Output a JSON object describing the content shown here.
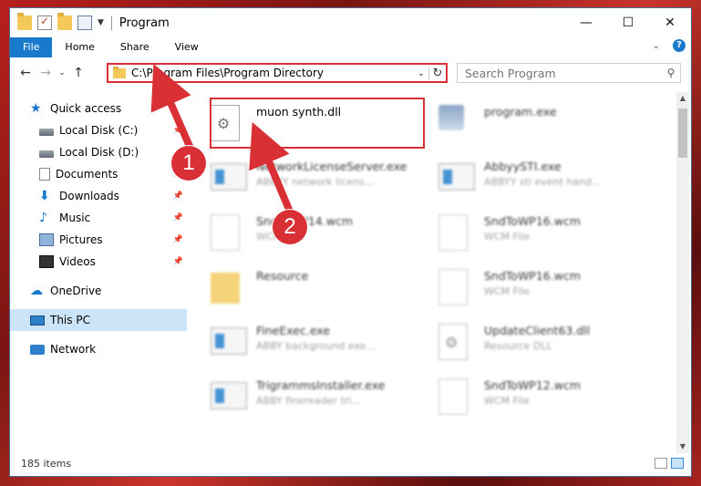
{
  "titlebar": {
    "title": "Program",
    "quick_access": [
      "folder-icon",
      "properties-check-icon",
      "new-folder-icon",
      "properties-icon"
    ],
    "minimize": "—",
    "maximize": "☐",
    "close": "✕"
  },
  "ribbon": {
    "tabs": [
      "File",
      "Home",
      "Share",
      "View"
    ],
    "help": "?"
  },
  "navbar": {
    "address": "C:\\Program Files\\Program Directory",
    "search_placeholder": "Search Program"
  },
  "sidebar": {
    "items": [
      {
        "label": "Quick access",
        "icon": "star-icon",
        "pinned": false
      },
      {
        "label": "Local Disk (C:)",
        "icon": "disk-icon",
        "pinned": true
      },
      {
        "label": "Local Disk (D:)",
        "icon": "disk-icon",
        "pinned": false
      },
      {
        "label": "Documents",
        "icon": "document-icon",
        "pinned": true
      },
      {
        "label": "Downloads",
        "icon": "download-icon",
        "pinned": true
      },
      {
        "label": "Music",
        "icon": "music-icon",
        "pinned": true
      },
      {
        "label": "Pictures",
        "icon": "picture-icon",
        "pinned": true
      },
      {
        "label": "Videos",
        "icon": "video-icon",
        "pinned": true
      },
      {
        "label": "OneDrive",
        "icon": "cloud-icon",
        "pinned": false
      },
      {
        "label": "This PC",
        "icon": "computer-icon",
        "pinned": false,
        "selected": true
      },
      {
        "label": "Network",
        "icon": "network-icon",
        "pinned": false
      }
    ]
  },
  "files": [
    {
      "name": "muon synth.dll",
      "type": "",
      "icon": "dll-icon",
      "highlighted": true
    },
    {
      "name": "program.exe",
      "type": "",
      "icon": "app-icon"
    },
    {
      "name": "NetworkLicenseServer.exe",
      "type": "ABBYY network licens...",
      "icon": "exe-icon"
    },
    {
      "name": "AbbyySTI.exe",
      "type": "ABBYY sti event hand...",
      "icon": "exe-icon"
    },
    {
      "name": "SndToWP14.wcm",
      "type": "WCM File",
      "icon": "blank-file-icon"
    },
    {
      "name": "SndToWP16.wcm",
      "type": "WCM File",
      "icon": "blank-file-icon"
    },
    {
      "name": "Resource",
      "type": "",
      "icon": "folder-icon"
    },
    {
      "name": "SndToWP16.wcm",
      "type": "WCM File",
      "icon": "blank-file-icon"
    },
    {
      "name": "FineExec.exe",
      "type": "ABBY background exe...",
      "icon": "exe-icon"
    },
    {
      "name": "UpdateClient63.dll",
      "type": "Resource DLL",
      "icon": "dll-icon"
    },
    {
      "name": "TrigrammsInstaller.exe",
      "type": "ABBY finereader tri...",
      "icon": "exe-icon"
    },
    {
      "name": "SndToWP12.wcm",
      "type": "WCM File",
      "icon": "blank-file-icon"
    }
  ],
  "status": {
    "item_count": "185 items"
  },
  "annotations": {
    "badge_1": "1",
    "badge_2": "2",
    "accent": "#d93036"
  }
}
